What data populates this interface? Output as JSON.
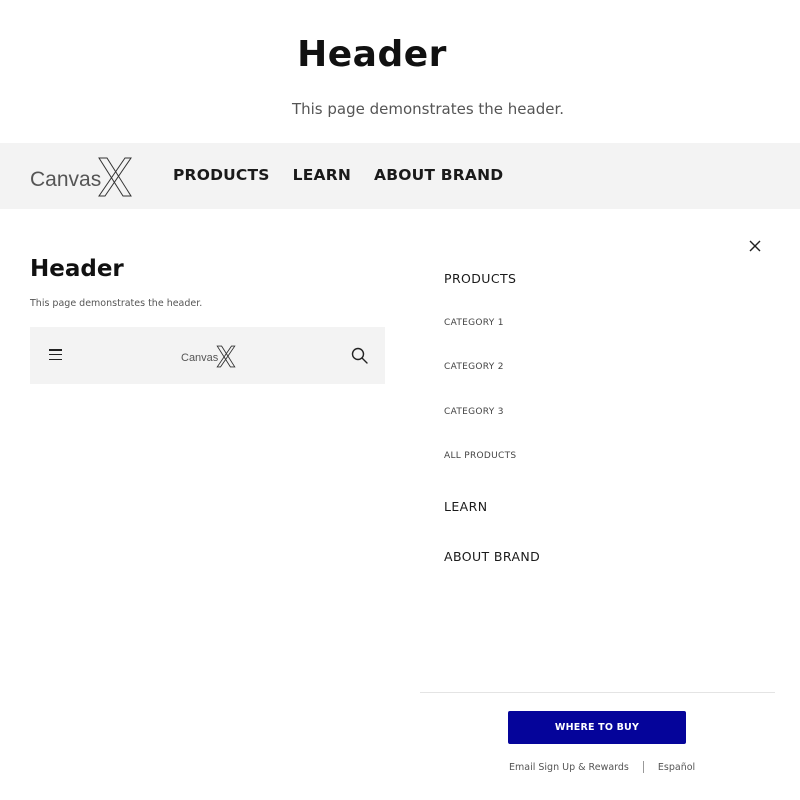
{
  "page": {
    "title": "Header",
    "subtitle": "This page demonstrates the header."
  },
  "brand": {
    "logo_text": "Canvas",
    "logo_mark": "X"
  },
  "desktop_nav": [
    {
      "label": "PRODUCTS"
    },
    {
      "label": "LEARN"
    },
    {
      "label": "ABOUT BRAND"
    }
  ],
  "mobile_preview": {
    "title": "Header",
    "subtitle": "This page demonstrates the header."
  },
  "drawer": {
    "menu": {
      "products": "PRODUCTS",
      "categories": [
        "CATEGORY 1",
        "CATEGORY 2",
        "CATEGORY 3",
        "ALL PRODUCTS"
      ],
      "learn": "LEARN",
      "about": "ABOUT BRAND"
    },
    "cta_label": "WHERE TO BUY",
    "footer_links": [
      "Email Sign Up & Rewards",
      "Español"
    ]
  },
  "icons": {
    "menu": "hamburger-icon",
    "search": "search-icon",
    "close": "close-icon"
  },
  "colors": {
    "header_bg": "#f3f3f3",
    "cta_bg": "#05049a",
    "text": "#1a1a1a"
  }
}
